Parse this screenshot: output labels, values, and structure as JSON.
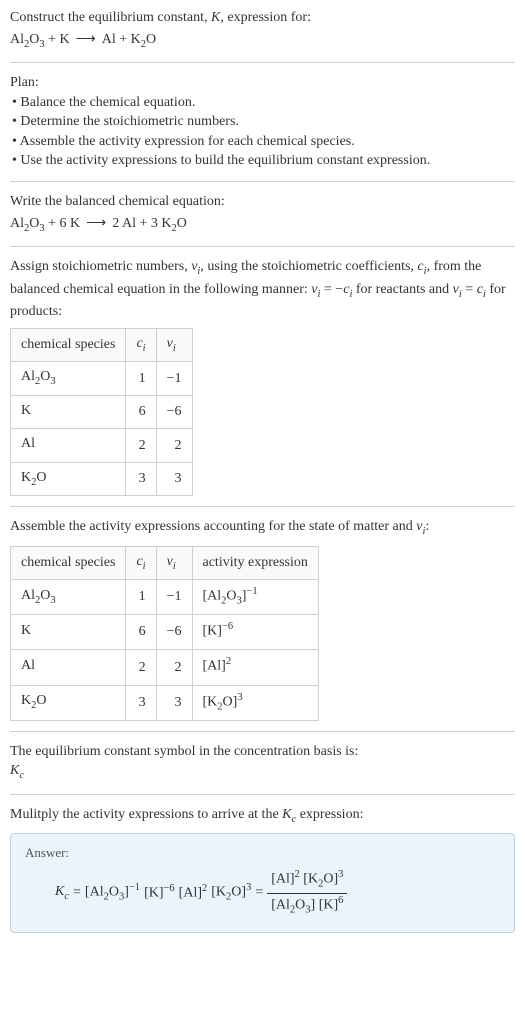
{
  "intro": {
    "line1": "Construct the equilibrium constant, ",
    "Ksym": "K",
    "line1b": ", expression for:",
    "unbalanced_lhs1": "Al",
    "unbalanced_lhs1_sub1": "2",
    "unbalanced_lhs1_mid": "O",
    "unbalanced_lhs1_sub2": "3",
    "plus": " + ",
    "unbalanced_lhs2": "K",
    "arrow": "⟶",
    "unbalanced_rhs1": "Al",
    "unbalanced_rhs2": "K",
    "unbalanced_rhs2_sub": "2",
    "unbalanced_rhs2_mid": "O"
  },
  "plan": {
    "heading": "Plan:",
    "items": [
      "Balance the chemical equation.",
      "Determine the stoichiometric numbers.",
      "Assemble the activity expression for each chemical species.",
      "Use the activity expressions to build the equilibrium constant expression."
    ]
  },
  "balanced": {
    "heading": "Write the balanced chemical equation:",
    "lhs_c1": "",
    "lhs1": "Al",
    "lhs1_s1": "2",
    "lhs1_m": "O",
    "lhs1_s2": "3",
    "plus": " + ",
    "lhs_c2": "6 ",
    "lhs2": "K",
    "arrow": "⟶",
    "rhs_c1": "2 ",
    "rhs1": "Al",
    "rhs_c2": "3 ",
    "rhs2": "K",
    "rhs2_s": "2",
    "rhs2_m": "O"
  },
  "stoich": {
    "text1": "Assign stoichiometric numbers, ",
    "nu": "ν",
    "sub_i": "i",
    "text2": ", using the stoichiometric coefficients, ",
    "c": "c",
    "text3": ", from the balanced chemical equation in the following manner: ",
    "rel1a": "ν",
    "rel1b": " = −",
    "rel1c": "c",
    "text4": " for reactants and ",
    "rel2a": "ν",
    "rel2b": " = ",
    "rel2c": "c",
    "text5": " for products:",
    "headers": {
      "h1": "chemical species",
      "h2": "c",
      "h2sub": "i",
      "h3": "ν",
      "h3sub": "i"
    },
    "rows": [
      {
        "sp": "Al",
        "s1": "2",
        "m": "O",
        "s2": "3",
        "ci": "1",
        "vi": "−1"
      },
      {
        "sp": "K",
        "s1": "",
        "m": "",
        "s2": "",
        "ci": "6",
        "vi": "−6"
      },
      {
        "sp": "Al",
        "s1": "",
        "m": "",
        "s2": "",
        "ci": "2",
        "vi": "2"
      },
      {
        "sp": "K",
        "s1": "2",
        "m": "O",
        "s2": "",
        "ci": "3",
        "vi": "3"
      }
    ]
  },
  "activity": {
    "heading1": "Assemble the activity expressions accounting for the state of matter and ",
    "nu": "ν",
    "sub_i": "i",
    "heading2": ":",
    "headers": {
      "h1": "chemical species",
      "h2": "c",
      "h2sub": "i",
      "h3": "ν",
      "h3sub": "i",
      "h4": "activity expression"
    },
    "rows": [
      {
        "sp": "Al",
        "s1": "2",
        "m": "O",
        "s2": "3",
        "ci": "1",
        "vi": "−1",
        "act_base": "[Al",
        "act_s1": "2",
        "act_m": "O",
        "act_s2": "3",
        "act_close": "]",
        "act_exp": "−1"
      },
      {
        "sp": "K",
        "s1": "",
        "m": "",
        "s2": "",
        "ci": "6",
        "vi": "−6",
        "act_base": "[K",
        "act_s1": "",
        "act_m": "",
        "act_s2": "",
        "act_close": "]",
        "act_exp": "−6"
      },
      {
        "sp": "Al",
        "s1": "",
        "m": "",
        "s2": "",
        "ci": "2",
        "vi": "2",
        "act_base": "[Al",
        "act_s1": "",
        "act_m": "",
        "act_s2": "",
        "act_close": "]",
        "act_exp": "2"
      },
      {
        "sp": "K",
        "s1": "2",
        "m": "O",
        "s2": "",
        "ci": "3",
        "vi": "3",
        "act_base": "[K",
        "act_s1": "2",
        "act_m": "O",
        "act_s2": "",
        "act_close": "]",
        "act_exp": "3"
      }
    ]
  },
  "basis": {
    "text": "The equilibrium constant symbol in the concentration basis is:",
    "K": "K",
    "sub": "c"
  },
  "final": {
    "heading": "Mulitply the activity expressions to arrive at the ",
    "K": "K",
    "sub": "c",
    "heading2": " expression:",
    "answer_label": "Answer:",
    "Ksym": "K",
    "Ksub": "c",
    "eq": " = ",
    "t1": "[Al",
    "t1s1": "2",
    "t1m": "O",
    "t1s2": "3",
    "t1c": "]",
    "t1e": "−1",
    "sp": " ",
    "t2": "[K]",
    "t2e": "−6",
    "t3": "[Al]",
    "t3e": "2",
    "t4": "[K",
    "t4s1": "2",
    "t4m": "O]",
    "t4e": "3",
    "eq2": " = ",
    "num1": "[Al]",
    "num1e": "2",
    "num2": "[K",
    "num2s": "2",
    "num2m": "O]",
    "num2e": "3",
    "den1": "[Al",
    "den1s1": "2",
    "den1m": "O",
    "den1s2": "3",
    "den1c": "]",
    "den2": "[K]",
    "den2e": "6"
  }
}
